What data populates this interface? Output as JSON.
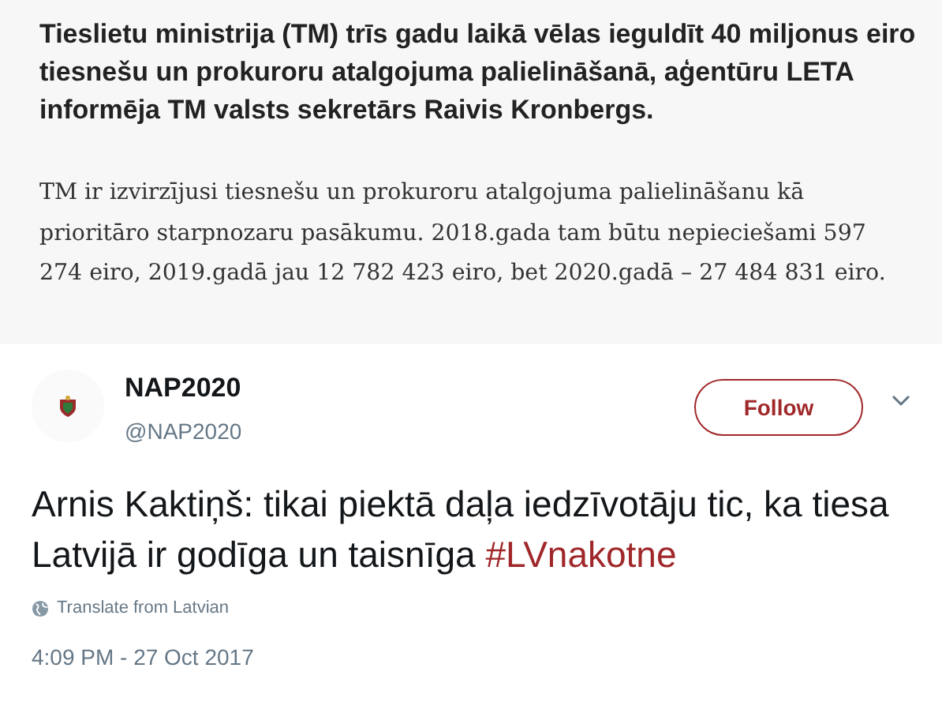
{
  "article": {
    "lead": "Tieslietu ministrija (TM) trīs gadu laikā vēlas ieguldīt 40 miljonus eiro tiesnešu un prokuroru atalgojuma palielināšanā, aģentūru LETA informēja TM valsts sekretārs Raivis Kronbergs.",
    "body": "TM ir izvirzījusi tiesnešu un prokuroru atalgojuma palielināšanu kā prioritāro starpnozaru pasākumu. 2018.gada tam būtu nepieciešami 597 274 eiro, 2019.gadā jau 12 782 423 eiro, bet 2020.gadā – 27 484 831 eiro."
  },
  "tweet": {
    "name": "NAP2020",
    "handle": "@NAP2020",
    "follow": "Follow",
    "text": "Arnis Kaktiņš: tikai piektā daļa iedzīvotāju tic, ka tiesa Latvijā ir godīga un taisnīga",
    "hashtag": "#LVnakotne",
    "translate": "Translate from Latvian",
    "time": "4:09 PM - 27 Oct 2017"
  }
}
